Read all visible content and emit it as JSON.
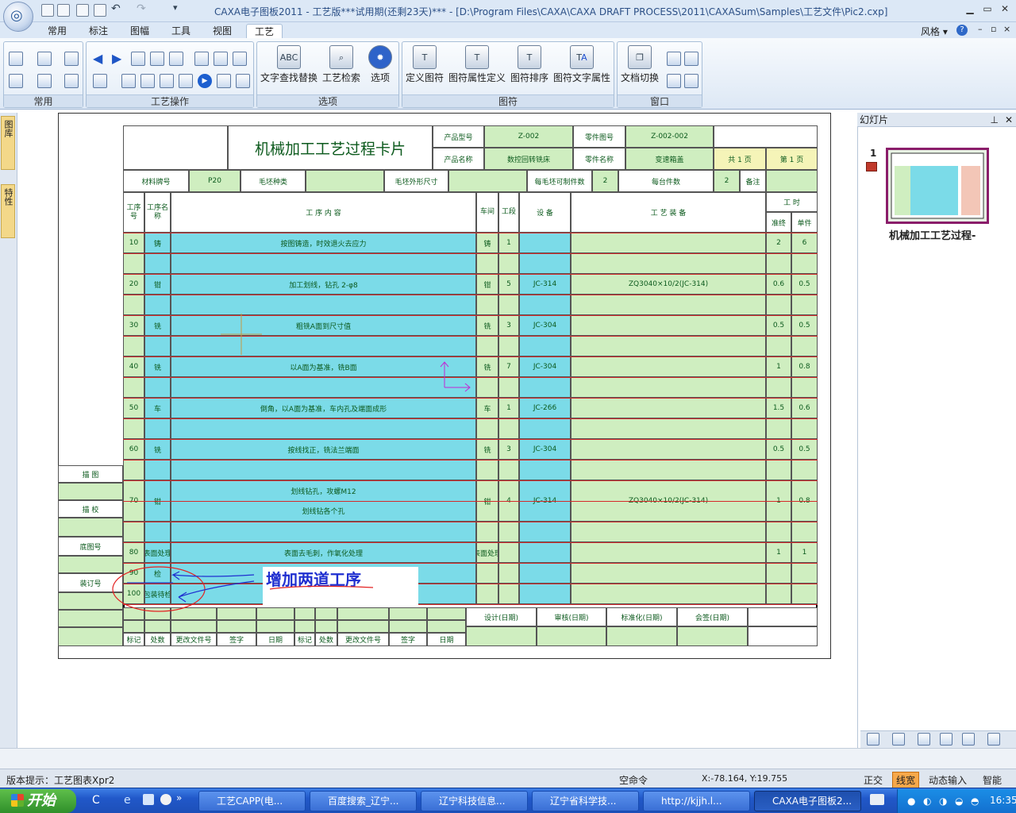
{
  "window": {
    "title": "CAXA电子图板2011 - 工艺版***试用期(还剩23天)*** - [D:\\Program Files\\CAXA\\CAXA DRAFT PROCESS\\2011\\CAXASum\\Samples\\工艺文件\\Pic2.cxp]",
    "style_label": "风格"
  },
  "menu_tabs": [
    "常用",
    "标注",
    "图幅",
    "工具",
    "视图",
    "工艺"
  ],
  "active_tab": "工艺",
  "ribbon": {
    "groups": [
      {
        "label": "常用"
      },
      {
        "label": "工艺操作"
      },
      {
        "label": "选项"
      },
      {
        "label": "图符"
      },
      {
        "label": "窗口"
      }
    ],
    "options_buttons": [
      "文字查找替换",
      "工艺检索",
      "选项"
    ],
    "symbol_buttons": [
      "定义图符",
      "图符属性定义",
      "图符排序",
      "图符文字属性"
    ],
    "window_buttons": [
      "文档切换"
    ]
  },
  "side_tabs": [
    "图库",
    "特性"
  ],
  "card": {
    "title": "机械加工工艺过程卡片",
    "product_model_label": "产品型号",
    "product_model": "Z-002",
    "part_drawing_no_label": "零件图号",
    "part_drawing_no": "Z-002-002",
    "product_name_label": "产品名称",
    "product_name": "数控回转铣床",
    "part_name_label": "零件名称",
    "part_name": "变速箱盖",
    "total_pages": "共 1 页",
    "page_no": "第 1 页",
    "material_label": "材料牌号",
    "material": "P20",
    "blank_type_label": "毛坯种类",
    "blank_size_label": "毛坯外形尺寸",
    "pieces_per_blank_label": "每毛坯可制件数",
    "pieces_per_blank": "2",
    "per_unit_label": "每台件数",
    "per_unit": "2",
    "remark_label": "备注",
    "col_headers": {
      "seq": "工序号",
      "name": "工序名称",
      "content": "工 序 内 容",
      "workshop": "车间",
      "section": "工段",
      "equipment": "设 备",
      "tooling": "工 艺 装 备",
      "hours": "工 时",
      "prep": "准终",
      "unit": "单件"
    },
    "rows": [
      {
        "seq": "10",
        "name": "铸",
        "content": "按图铸造，时效退火去应力",
        "ws": "铸",
        "sec": "1",
        "eq": "",
        "tool": "",
        "prep": "2",
        "unit": "6"
      },
      {
        "seq": "20",
        "name": "钳",
        "content": "加工划线，钻孔 2-φ8",
        "ws": "钳",
        "sec": "5",
        "eq": "JC-314",
        "tool": "ZQ3040×10/2(JC-314)",
        "prep": "0.6",
        "unit": "0.5"
      },
      {
        "seq": "30",
        "name": "铣",
        "content": "粗铣A面到尺寸值",
        "ws": "铣",
        "sec": "3",
        "eq": "JC-304",
        "tool": "",
        "prep": "0.5",
        "unit": "0.5"
      },
      {
        "seq": "40",
        "name": "铣",
        "content": "以A面为基准，铣B面",
        "ws": "铣",
        "sec": "7",
        "eq": "JC-304",
        "tool": "",
        "prep": "1",
        "unit": "0.8"
      },
      {
        "seq": "50",
        "name": "车",
        "content": "倒角，以A面为基准，车内孔及端面成形",
        "ws": "车",
        "sec": "1",
        "eq": "JC-266",
        "tool": "",
        "prep": "1.5",
        "unit": "0.6"
      },
      {
        "seq": "60",
        "name": "铣",
        "content": "按线找正，铣法兰端面",
        "ws": "铣",
        "sec": "3",
        "eq": "JC-304",
        "tool": "",
        "prep": "0.5",
        "unit": "0.5"
      },
      {
        "seq": "70",
        "name": "钳",
        "content": "划线钻孔，攻螺M12",
        "content2": "划线钻各个孔",
        "ws": "钳",
        "sec": "4",
        "eq": "JC-314",
        "tool": "ZQ3040×10/2(JC-314)",
        "prep": "1",
        "unit": "0.8"
      },
      {
        "seq": "80",
        "name": "表面处理",
        "content": "表面去毛刺，作氧化处理",
        "ws": "表面处理",
        "sec": "",
        "eq": "",
        "tool": "",
        "prep": "1",
        "unit": "1"
      },
      {
        "seq": "90",
        "name": "检",
        "content": "",
        "ws": "",
        "sec": "",
        "eq": "",
        "tool": "",
        "prep": "",
        "unit": ""
      },
      {
        "seq": "100",
        "name": "包装待检",
        "content": "",
        "ws": "",
        "sec": "",
        "eq": "",
        "tool": "",
        "prep": "",
        "unit": ""
      }
    ],
    "left_labels": [
      "描 图",
      "描 校",
      "底图号",
      "装订号"
    ],
    "sign_labels": [
      "设计(日期)",
      "审核(日期)",
      "标准化(日期)",
      "会签(日期)"
    ],
    "footer_labels": [
      "标记",
      "处数",
      "更改文件号",
      "签字",
      "日期",
      "标记",
      "处数",
      "更改文件号",
      "签字",
      "日期"
    ],
    "annotation": "增加两道工序"
  },
  "right_panel": {
    "title": "幻灯片",
    "slide_number": "1",
    "slide_caption": "机械加工工艺过程-"
  },
  "status": {
    "version_hint": "版本提示：工艺图表Xpr2",
    "command": "空命令",
    "coords": "X:-78.164, Y:19.755",
    "ortho": "正交",
    "linewidth": "线宽",
    "dynamic_input": "动态输入",
    "smart": "智能"
  },
  "taskbar": {
    "start": "开始",
    "items": [
      "工艺CAPP(电...",
      "百度搜索_辽宁...",
      "辽宁科技信息...",
      "辽宁省科学技...",
      "http://kjjh.l...",
      "CAXA电子图板2..."
    ],
    "clock": "16:35"
  }
}
